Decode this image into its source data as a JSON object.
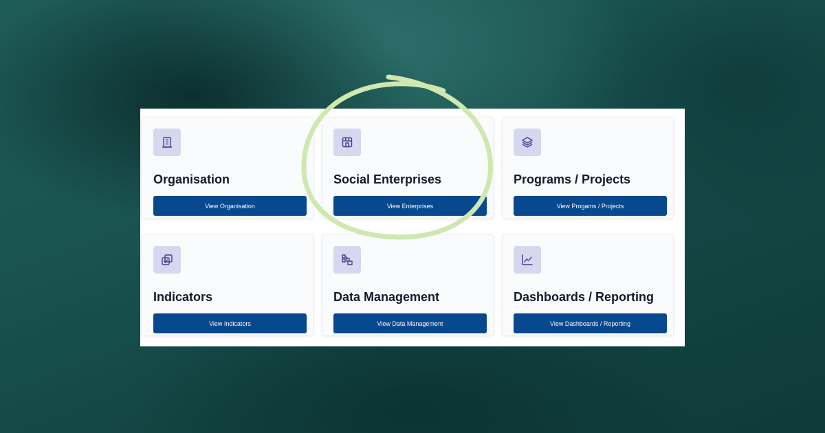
{
  "cards": [
    {
      "title": "Organisation",
      "button_label": "View Organisation",
      "icon": "building-icon"
    },
    {
      "title": "Social Enterprises",
      "button_label": "View Enterprises",
      "icon": "storefront-icon"
    },
    {
      "title": "Programs / Projects",
      "button_label": "View Progams / Projects",
      "icon": "layers-icon"
    },
    {
      "title": "Indicators",
      "button_label": "View Indicators",
      "icon": "checklist-icon"
    },
    {
      "title": "Data Management",
      "button_label": "View Data Management",
      "icon": "data-blocks-icon"
    },
    {
      "title": "Dashboards / Reporting",
      "button_label": "View Dashboards / Reporting",
      "icon": "line-chart-icon"
    }
  ],
  "colors": {
    "button": "#07488f",
    "icon_bg": "#d5d8ef",
    "icon_stroke": "#4a3d8f",
    "highlight": "#cfe8b0",
    "background": "#1a5451"
  }
}
